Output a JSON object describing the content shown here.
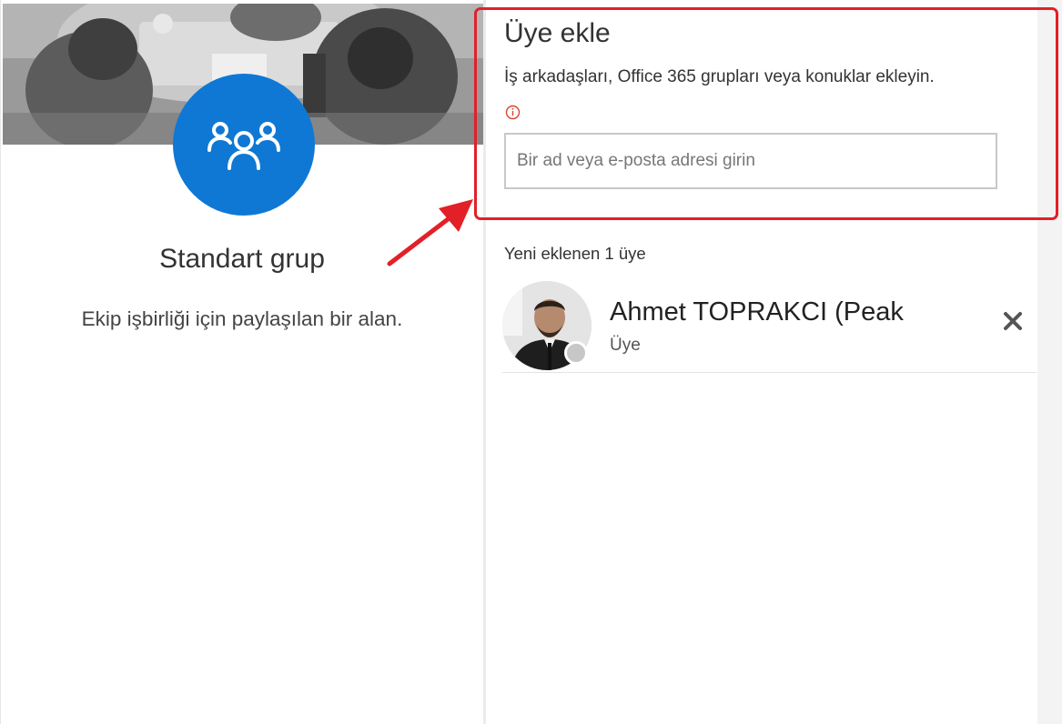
{
  "group": {
    "type": "Standart grup",
    "description": "Ekip işbirliği için paylaşılan bir alan.",
    "icon": "group-people-icon",
    "accent_color": "#0f78d4"
  },
  "add_member": {
    "title": "Üye ekle",
    "subtitle": "İş arkadaşları, Office 365 grupları veya konuklar ekleyin.",
    "info_icon": "info-circle-icon",
    "search_placeholder": "Bir ad veya e-posta adresi girin",
    "search_value": ""
  },
  "new_members": {
    "label": "Yeni eklenen 1 üye",
    "members": [
      {
        "name": "Ahmet TOPRAKCI (Peak",
        "role": "Üye",
        "presence": "offline",
        "remove_icon": "close-icon"
      }
    ]
  },
  "annotation": {
    "highlight_color": "#e22028"
  }
}
